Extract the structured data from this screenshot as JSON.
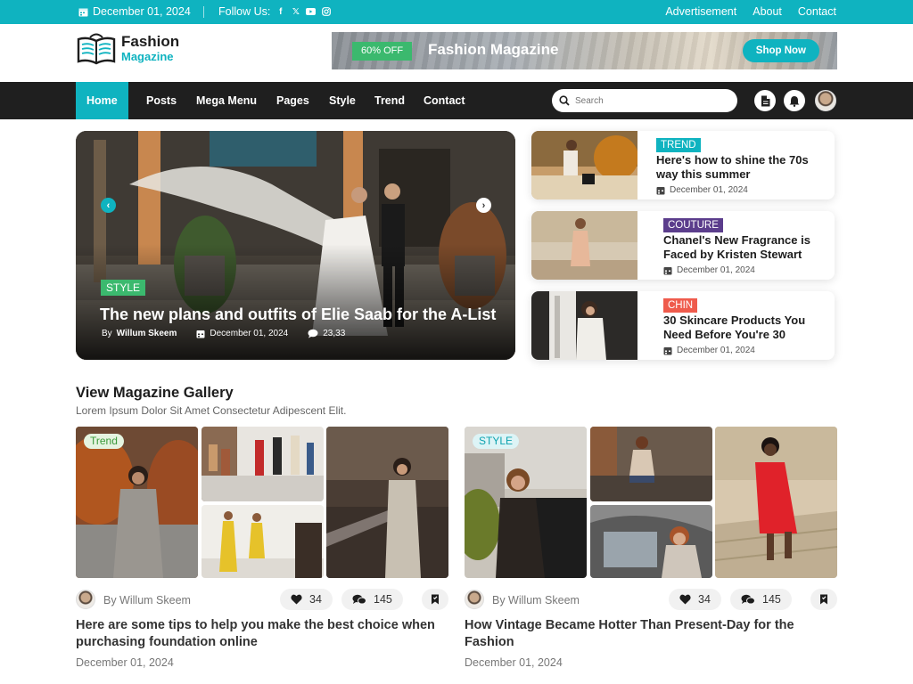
{
  "topbar": {
    "date": "December 01, 2024",
    "follow_label": "Follow Us:",
    "social_icons": [
      "facebook-icon",
      "x-icon",
      "youtube-icon",
      "instagram-icon"
    ],
    "links": [
      "Advertisement",
      "About",
      "Contact"
    ],
    "bg_color": "#0fb3c0"
  },
  "logo": {
    "line1": "Fashion",
    "line2": "Magazine"
  },
  "banner": {
    "discount": "60% OFF",
    "title": "Fashion Magazine",
    "button": "Shop Now"
  },
  "nav": {
    "items": [
      "Home",
      "Posts",
      "Mega Menu",
      "Pages",
      "Style",
      "Trend",
      "Contact"
    ],
    "active": "Home",
    "search_placeholder": "Search"
  },
  "hero": {
    "tag": "STYLE",
    "title": "The new plans and outfits of Elie Saab for the A-List",
    "author_prefix": "By",
    "author": "Willum Skeem",
    "date": "December 01, 2024",
    "comments": "23,33"
  },
  "side_cards": [
    {
      "tag": "TREND",
      "tag_color": "#0fb3c0",
      "title": "Here's how to shine the 70s way this summer",
      "date": "December 01, 2024"
    },
    {
      "tag": "COUTURE",
      "tag_color": "#5b3d8c",
      "title": "Chanel's New Fragrance is Faced by Kristen Stewart",
      "date": "December 01, 2024"
    },
    {
      "tag": "CHIN",
      "tag_color": "#ef5b4c",
      "title": "30 Skincare Products You Need Before You're 30",
      "date": "December 01, 2024"
    }
  ],
  "gallery_section": {
    "title": "View Magazine Gallery",
    "subtitle": "Lorem Ipsum Dolor Sit Amet  Consectetur Adipescent Elit."
  },
  "gallery_posts": [
    {
      "tag": "Trend",
      "author": "By Willum Skeem",
      "likes": "34",
      "comments": "145",
      "title": "Here are some tips to help you make the best choice when purchasing foundation online",
      "date": "December 01, 2024"
    },
    {
      "tag": "STYLE",
      "author": "By Willum Skeem",
      "likes": "34",
      "comments": "145",
      "title": "How Vintage Became Hotter Than Present-Day for the Fashion",
      "date": "December 01, 2024"
    }
  ]
}
